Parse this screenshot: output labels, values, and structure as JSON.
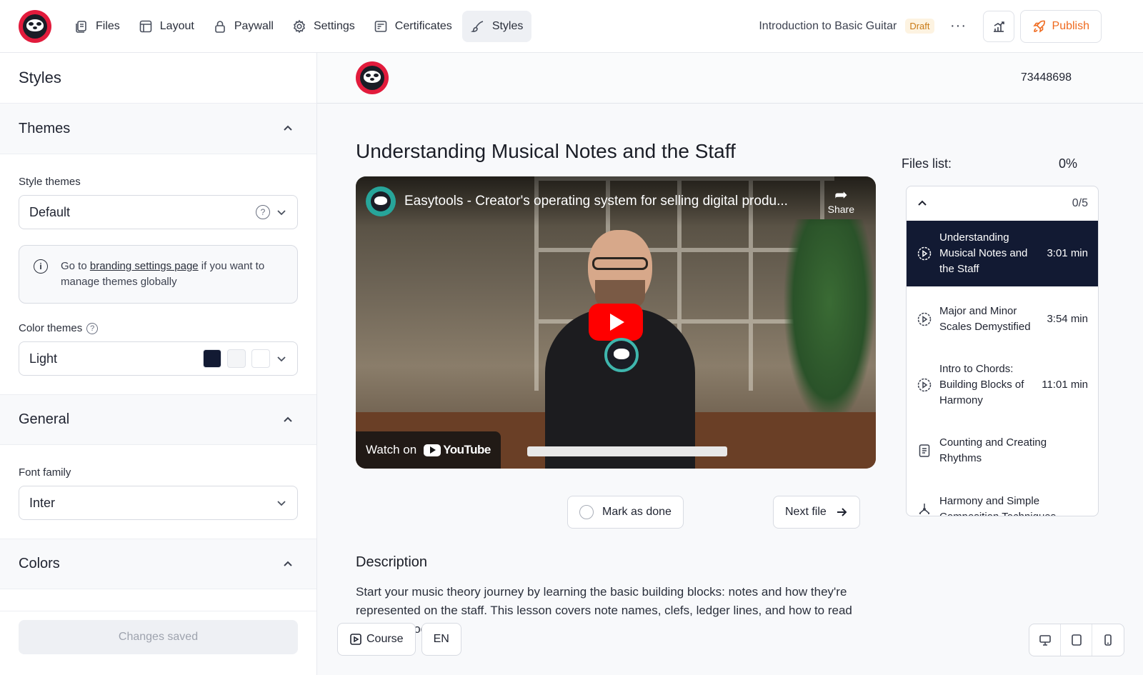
{
  "nav": {
    "items": [
      {
        "label": "Files",
        "icon": "files-icon"
      },
      {
        "label": "Layout",
        "icon": "layout-icon"
      },
      {
        "label": "Paywall",
        "icon": "lock-icon"
      },
      {
        "label": "Settings",
        "icon": "gear-icon"
      },
      {
        "label": "Certificates",
        "icon": "certificate-icon"
      },
      {
        "label": "Styles",
        "icon": "brush-icon",
        "active": true
      }
    ]
  },
  "header": {
    "course_title": "Introduction to Basic Guitar",
    "status_badge": "Draft",
    "more_label": "···",
    "publish_label": "Publish"
  },
  "sidebar": {
    "title": "Styles",
    "themes": {
      "heading": "Themes",
      "style_label": "Style themes",
      "style_value": "Default",
      "info_prefix": "Go to ",
      "info_link": "branding settings page",
      "info_suffix": " if you want to manage themes globally",
      "color_label": "Color themes",
      "color_value": "Light",
      "swatches": [
        "#121a33",
        "#f4f5f7",
        "#ffffff"
      ]
    },
    "general": {
      "heading": "General",
      "font_label": "Font family",
      "font_value": "Inter"
    },
    "colors": {
      "heading": "Colors"
    },
    "footer_button": "Changes saved"
  },
  "preview": {
    "course_id": "73448698",
    "lesson_title": "Understanding Musical Notes and the Staff",
    "video": {
      "title": "Easytools - Creator's operating system for selling digital produ...",
      "share_label": "Share",
      "watch_on": "Watch on",
      "youtube": "YouTube"
    },
    "mark_done_label": "Mark as done",
    "next_file_label": "Next file",
    "description_title": "Description",
    "description_text": "Start your music theory journey by learning the basic building blocks: notes and how they're represented on the staff. This lesson covers note names, clefs, ledger lines, and how to read simple melodies.",
    "files": {
      "label": "Files list:",
      "progress": "0%",
      "count": "0/5",
      "items": [
        {
          "name": "Understanding Musical Notes and the Staff",
          "duration": "3:01 min",
          "type": "video",
          "active": true
        },
        {
          "name": "Major and Minor Scales Demystified",
          "duration": "3:54 min",
          "type": "video"
        },
        {
          "name": "Intro to Chords: Building Blocks of Harmony",
          "duration": "11:01 min",
          "type": "video"
        },
        {
          "name": "Counting and Creating Rhythms",
          "duration": "",
          "type": "document"
        },
        {
          "name": "Harmony and Simple Composition Techniques",
          "duration": "",
          "type": "pdf"
        }
      ]
    }
  },
  "floating": {
    "course_label": "Course",
    "language_label": "EN"
  }
}
